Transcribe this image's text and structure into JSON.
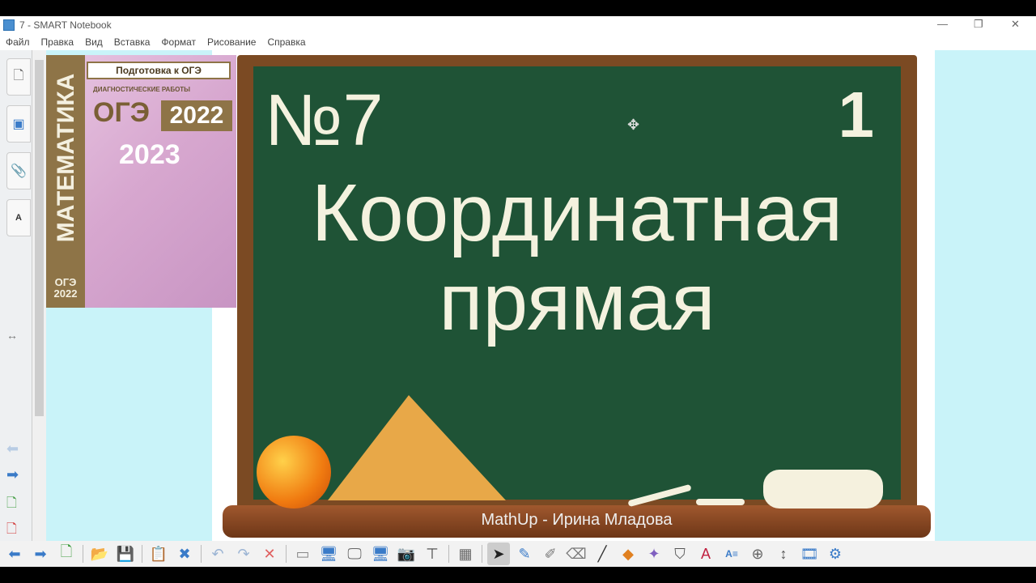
{
  "window": {
    "title": "7 - SMART Notebook",
    "minimize": "—",
    "restore": "❐",
    "close": "✕"
  },
  "menu": [
    "Файл",
    "Правка",
    "Вид",
    "Вставка",
    "Формат",
    "Рисование",
    "Справка"
  ],
  "book": {
    "header": "Подготовка к ОГЭ",
    "subtitle": "ДИАГНОСТИЧЕСКИЕ РАБОТЫ",
    "exam": "ОГЭ",
    "year1": "2022",
    "year2": "2023",
    "spine": "МАТЕМАТИКА",
    "spine_bottom": "ОГЭ 2022"
  },
  "slide": {
    "number_label": "№7",
    "page_num": "1",
    "title": "Координатная прямая",
    "credit": "MathUp - Ирина Младова"
  },
  "toolbar": [
    "back-icon",
    "forward-icon",
    "add-page-icon",
    "open-icon",
    "save-icon",
    "paste-icon",
    "delete-page-icon",
    "undo-icon",
    "redo-icon",
    "delete-icon",
    "screen-shade-icon",
    "full-screen-icon",
    "transparent-bg-icon",
    "dual-view-icon",
    "capture-icon",
    "document-camera-icon",
    "table-icon",
    "select-icon",
    "pen-icon",
    "creative-pen-icon",
    "eraser-icon",
    "line-icon",
    "shapes-icon",
    "magic-pen-icon",
    "fill-icon",
    "text-icon",
    "properties-icon",
    "measure-icon",
    "move-toolbar-icon",
    "video-icon",
    "addons-icon"
  ]
}
